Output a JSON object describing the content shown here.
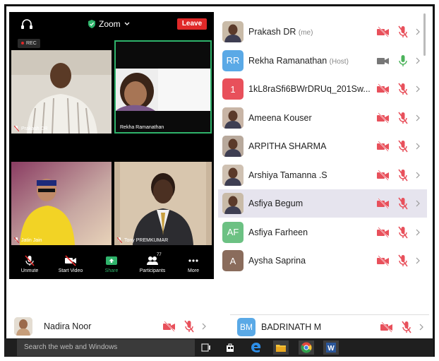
{
  "zoom": {
    "title": "Zoom",
    "leave_label": "Leave",
    "rec_label": "REC",
    "tiles": [
      {
        "name": "Prakash DR"
      },
      {
        "name": "Rekha Ramanathan"
      },
      {
        "name": "Jatin Jain"
      },
      {
        "name": "Tony PREMKUMAR"
      }
    ],
    "controls": {
      "unmute": "Unmute",
      "start_video": "Start Video",
      "share": "Share",
      "participants": "Participants",
      "participants_count": "77",
      "more": "More"
    },
    "accent_green": "#2fb36b",
    "leave_color": "#e02828"
  },
  "participants": [
    {
      "name": "Prakash DR",
      "tag": "(me)",
      "avatar_type": "photo",
      "cam": "off",
      "mic": "off"
    },
    {
      "name": "Rekha Ramanathan",
      "tag": "(Host)",
      "avatar_type": "initials",
      "initials": "RR",
      "avatar_color": "#5aa9e6",
      "cam": "on",
      "mic": "on"
    },
    {
      "name": "1kL8raSfi6BWrDRUq_201Sw...",
      "tag": "",
      "avatar_type": "initials",
      "initials": "1",
      "avatar_color": "#e8505b",
      "cam": "off",
      "mic": "off"
    },
    {
      "name": "Ameena Kouser",
      "tag": "",
      "avatar_type": "photo",
      "cam": "off",
      "mic": "off"
    },
    {
      "name": "ARPITHA SHARMA",
      "tag": "",
      "avatar_type": "photo",
      "cam": "off",
      "mic": "off"
    },
    {
      "name": "Arshiya Tamanna .S",
      "tag": "",
      "avatar_type": "photo",
      "cam": "off",
      "mic": "off"
    },
    {
      "name": "Asfiya Begum",
      "tag": "",
      "avatar_type": "photo",
      "cam": "off",
      "mic": "off",
      "highlight": true
    },
    {
      "name": "Asfiya Farheen",
      "tag": "",
      "avatar_type": "initials",
      "initials": "AF",
      "avatar_color": "#6cc183",
      "cam": "off",
      "mic": "off"
    },
    {
      "name": "Aysha Saprina",
      "tag": "",
      "avatar_type": "initials",
      "initials": "A",
      "avatar_color": "#8a6c5c",
      "cam": "off",
      "mic": "off"
    }
  ],
  "bottom_left": {
    "name": "Nadira Noor"
  },
  "bottom_right": {
    "name": "BADRINATH M",
    "initials": "BM",
    "avatar_color": "#5aa9e6"
  },
  "taskbar": {
    "search_placeholder": "Search the web and Windows",
    "icons": [
      "task-view-icon",
      "store-icon",
      "edge-icon",
      "file-explorer-icon",
      "chrome-icon",
      "word-icon"
    ]
  }
}
